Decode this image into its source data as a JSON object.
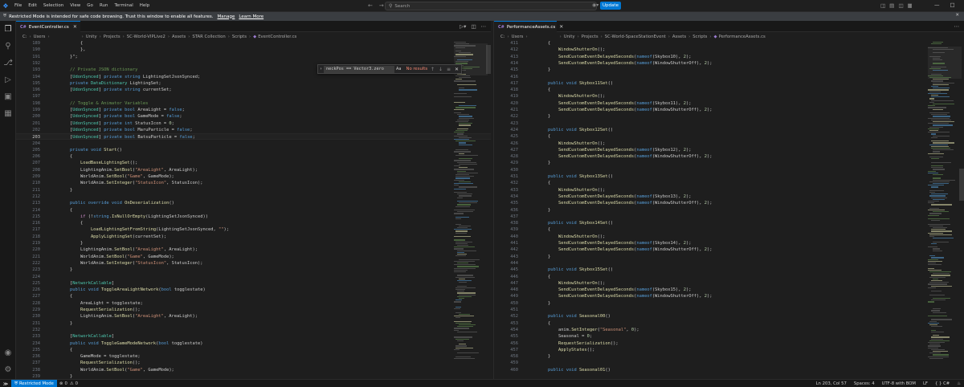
{
  "titlebar": {
    "menu": [
      "File",
      "Edit",
      "Selection",
      "View",
      "Go",
      "Run",
      "Terminal",
      "Help"
    ],
    "search_placeholder": "Search",
    "update_label": "Update"
  },
  "banner": {
    "text": "Restricted Mode is intended for safe code browsing. Trust this window to enable all features.",
    "manage": "Manage",
    "learn_more": "Learn More"
  },
  "left_editor": {
    "tab": "EventController.cs",
    "breadcrumb": [
      "C:",
      "Users",
      "",
      "Unity",
      "Projects",
      "SC-World-VIPLive2",
      "Assets",
      "STAR Collection",
      "Scripts",
      "EventController.cs"
    ],
    "find": {
      "query": "neckPos == Vector3.zero",
      "options": "Aa",
      "result": "No results"
    },
    "current_line": "203",
    "lines": [
      {
        "n": "189",
        "t": "            {"
      },
      {
        "n": "190",
        "t": "            },"
      },
      {
        "n": "191",
        "t": "        }\";"
      },
      {
        "n": "192",
        "t": ""
      },
      {
        "n": "193",
        "t": "        // Private JSON dictionary"
      },
      {
        "n": "194",
        "t": "        [UdonSynced] private string LightingSetJsonSynced;"
      },
      {
        "n": "195",
        "t": "        private DataDictionary LightingSet;"
      },
      {
        "n": "196",
        "t": "        [UdonSynced] private string currentSet;"
      },
      {
        "n": "197",
        "t": ""
      },
      {
        "n": "198",
        "t": "        // Toggle & Animator Variables"
      },
      {
        "n": "199",
        "t": "        [UdonSynced] private bool AreaLight = false;"
      },
      {
        "n": "200",
        "t": "        [UdonSynced] private bool GameMode = false;"
      },
      {
        "n": "201",
        "t": "        [UdonSynced] private int StatusIcon = 0;"
      },
      {
        "n": "202",
        "t": "        [UdonSynced] private bool MaruParticle = false;"
      },
      {
        "n": "203",
        "t": "        [UdonSynced] private bool BatsuParticle = false;"
      },
      {
        "n": "204",
        "t": ""
      },
      {
        "n": "205",
        "t": "        private void Start()"
      },
      {
        "n": "206",
        "t": "        {"
      },
      {
        "n": "207",
        "t": "            LoadBaseLightingSet();"
      },
      {
        "n": "208",
        "t": "            LightingAnim.SetBool(\"AreaLight\", AreaLight);"
      },
      {
        "n": "209",
        "t": "            WorldAnim.SetBool(\"Game\", GameMode);"
      },
      {
        "n": "210",
        "t": "            WorldAnim.SetInteger(\"StatusIcon\", StatusIcon);"
      },
      {
        "n": "211",
        "t": "        }"
      },
      {
        "n": "212",
        "t": ""
      },
      {
        "n": "213",
        "t": "        public override void OnDeserialization()"
      },
      {
        "n": "214",
        "t": "        {"
      },
      {
        "n": "215",
        "t": "            if (!string.IsNullOrEmpty(LightingSetJsonSynced))"
      },
      {
        "n": "216",
        "t": "            {"
      },
      {
        "n": "217",
        "t": "                LoadLightingSetFromString(LightingSetJsonSynced, \"\");"
      },
      {
        "n": "218",
        "t": "                ApplyLightingSet(currentSet);"
      },
      {
        "n": "219",
        "t": "            }"
      },
      {
        "n": "220",
        "t": "            LightingAnim.SetBool(\"AreaLight\", AreaLight);"
      },
      {
        "n": "221",
        "t": "            WorldAnim.SetBool(\"Game\", GameMode);"
      },
      {
        "n": "222",
        "t": "            WorldAnim.SetInteger(\"StatusIcon\", StatusIcon);"
      },
      {
        "n": "223",
        "t": "        }"
      },
      {
        "n": "224",
        "t": ""
      },
      {
        "n": "225",
        "t": "        [NetworkCallable]"
      },
      {
        "n": "226",
        "t": "        public void ToggleAreaLightNetwork(bool togglestate)"
      },
      {
        "n": "227",
        "t": "        {"
      },
      {
        "n": "228",
        "t": "            AreaLight = togglestate;"
      },
      {
        "n": "229",
        "t": "            RequestSerialization();"
      },
      {
        "n": "230",
        "t": "            LightingAnim.SetBool(\"AreaLight\", AreaLight);"
      },
      {
        "n": "231",
        "t": "        }"
      },
      {
        "n": "232",
        "t": ""
      },
      {
        "n": "233",
        "t": "        [NetworkCallable]"
      },
      {
        "n": "234",
        "t": "        public void ToggleGameModeNetwork(bool togglestate)"
      },
      {
        "n": "235",
        "t": "        {"
      },
      {
        "n": "236",
        "t": "            GameMode = togglestate;"
      },
      {
        "n": "237",
        "t": "            RequestSerialization();"
      },
      {
        "n": "238",
        "t": "            WorldAnim.SetBool(\"Game\", GameMode);"
      },
      {
        "n": "239",
        "t": "        }"
      }
    ]
  },
  "right_editor": {
    "tab": "PerformanceAssets.cs",
    "breadcrumb": [
      "C:",
      "Users",
      "",
      "Unity",
      "Projects",
      "SC-World-SpaceStationEvent",
      "Assets",
      "Scripts",
      "PerformanceAssets.cs"
    ],
    "lines": [
      {
        "n": "411",
        "t": "        {"
      },
      {
        "n": "412",
        "t": "            WindowShutterOn();"
      },
      {
        "n": "413",
        "t": "            SendCustomEventDelayedSeconds(nameof(Skybox10), 2);"
      },
      {
        "n": "414",
        "t": "            SendCustomEventDelayedSeconds(nameof(WindowShutterOff), 2);"
      },
      {
        "n": "415",
        "t": "        }"
      },
      {
        "n": "416",
        "t": ""
      },
      {
        "n": "417",
        "t": "        public void Skybox11Set()"
      },
      {
        "n": "418",
        "t": "        {"
      },
      {
        "n": "419",
        "t": "            WindowShutterOn();"
      },
      {
        "n": "420",
        "t": "            SendCustomEventDelayedSeconds(nameof(Skybox11), 2);"
      },
      {
        "n": "421",
        "t": "            SendCustomEventDelayedSeconds(nameof(WindowShutterOff), 2);"
      },
      {
        "n": "422",
        "t": "        }"
      },
      {
        "n": "423",
        "t": ""
      },
      {
        "n": "424",
        "t": "        public void Skybox12Set()"
      },
      {
        "n": "425",
        "t": "        {"
      },
      {
        "n": "426",
        "t": "            WindowShutterOn();"
      },
      {
        "n": "427",
        "t": "            SendCustomEventDelayedSeconds(nameof(Skybox12), 2);"
      },
      {
        "n": "428",
        "t": "            SendCustomEventDelayedSeconds(nameof(WindowShutterOff), 2);"
      },
      {
        "n": "429",
        "t": "        }"
      },
      {
        "n": "430",
        "t": ""
      },
      {
        "n": "431",
        "t": "        public void Skybox13Set()"
      },
      {
        "n": "432",
        "t": "        {"
      },
      {
        "n": "433",
        "t": "            WindowShutterOn();"
      },
      {
        "n": "434",
        "t": "            SendCustomEventDelayedSeconds(nameof(Skybox13), 2);"
      },
      {
        "n": "435",
        "t": "            SendCustomEventDelayedSeconds(nameof(WindowShutterOff), 2);"
      },
      {
        "n": "436",
        "t": "        }"
      },
      {
        "n": "437",
        "t": ""
      },
      {
        "n": "438",
        "t": "        public void Skybox14Set()"
      },
      {
        "n": "439",
        "t": "        {"
      },
      {
        "n": "440",
        "t": "            WindowShutterOn();"
      },
      {
        "n": "441",
        "t": "            SendCustomEventDelayedSeconds(nameof(Skybox14), 2);"
      },
      {
        "n": "442",
        "t": "            SendCustomEventDelayedSeconds(nameof(WindowShutterOff), 2);"
      },
      {
        "n": "443",
        "t": "        }"
      },
      {
        "n": "444",
        "t": ""
      },
      {
        "n": "445",
        "t": "        public void Skybox15Set()"
      },
      {
        "n": "446",
        "t": "        {"
      },
      {
        "n": "447",
        "t": "            WindowShutterOn();"
      },
      {
        "n": "448",
        "t": "            SendCustomEventDelayedSeconds(nameof(Skybox15), 2);"
      },
      {
        "n": "449",
        "t": "            SendCustomEventDelayedSeconds(nameof(WindowShutterOff), 2);"
      },
      {
        "n": "450",
        "t": "        }"
      },
      {
        "n": "451",
        "t": ""
      },
      {
        "n": "452",
        "t": "        public void Seasonal00()"
      },
      {
        "n": "453",
        "t": "        {"
      },
      {
        "n": "454",
        "t": "            anim.SetInteger(\"Seasonal\", 0);"
      },
      {
        "n": "455",
        "t": "            Seasonal = 0;"
      },
      {
        "n": "456",
        "t": "            RequestSerialization();"
      },
      {
        "n": "457",
        "t": "            ApplyStates();"
      },
      {
        "n": "458",
        "t": "        }"
      },
      {
        "n": "459",
        "t": ""
      },
      {
        "n": "460",
        "t": "        public void Seasonal01()"
      }
    ]
  },
  "statusbar": {
    "restricted": "Restricted Mode",
    "errors": "0",
    "warnings": "0",
    "position": "Ln 203, Col 57",
    "spaces": "Spaces: 4",
    "encoding": "UTF-8 with BOM",
    "eol": "LF",
    "language": "C#"
  },
  "colors": {
    "accent": "#0078d4",
    "keyword": "#569cd6",
    "type": "#4ec9b0",
    "function": "#dcdcaa",
    "string": "#ce9178",
    "comment": "#6a9955",
    "number": "#b5cea8"
  }
}
